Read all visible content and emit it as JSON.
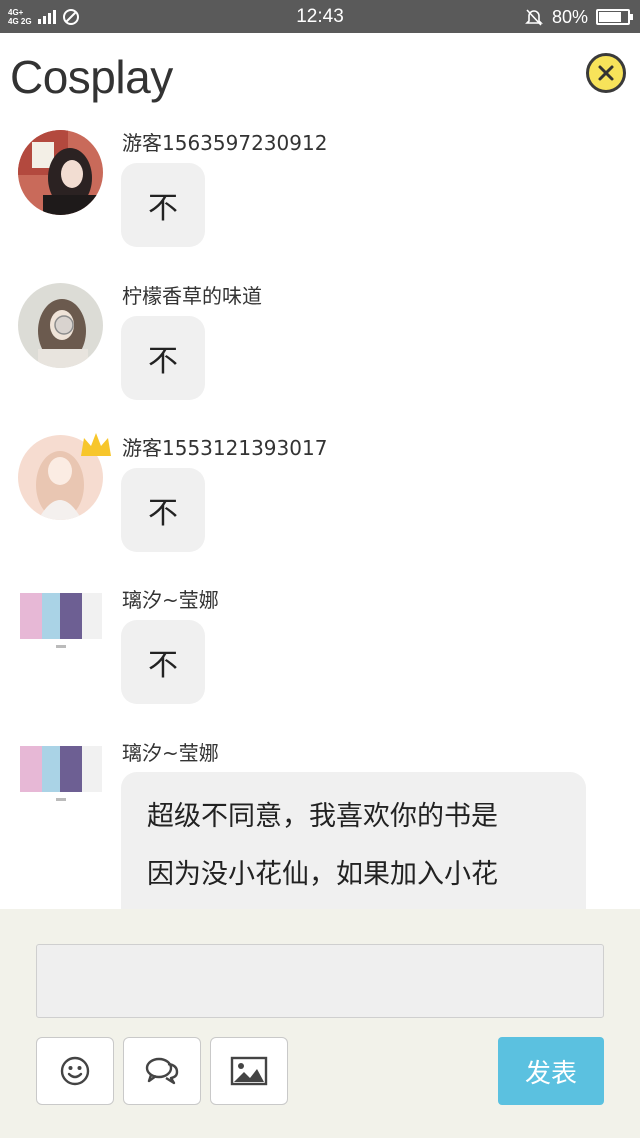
{
  "status_bar": {
    "network_top": "4G+",
    "network_bottom": "4G 2G",
    "time": "12:43",
    "battery_percent": "80%",
    "battery_level": 0.8
  },
  "header": {
    "title": "Cosplay",
    "close_icon": "close-circle-icon"
  },
  "messages": [
    {
      "username": "游客1563597230912",
      "text": "不"
    },
    {
      "username": "柠檬香草的味道",
      "text": "不"
    },
    {
      "username": "游客1553121393017",
      "text": "不"
    },
    {
      "username": "璃汐~莹娜",
      "text": "不"
    },
    {
      "username": "璃汐~莹娜",
      "text_lines": [
        "超级不同意，我喜欢你的书是",
        "因为没小花仙，如果加入小花"
      ]
    }
  ],
  "composer": {
    "input_value": "",
    "tools": [
      "emoji-icon",
      "chat-bubbles-icon",
      "image-icon"
    ],
    "send_label": "发表"
  },
  "colors": {
    "status_bar": "#5a5a5a",
    "close_button": "#f7e35a",
    "send_button": "#5bc1e0",
    "composer_bg": "#f2f2ea",
    "bubble_bg": "#f0f0f0"
  }
}
